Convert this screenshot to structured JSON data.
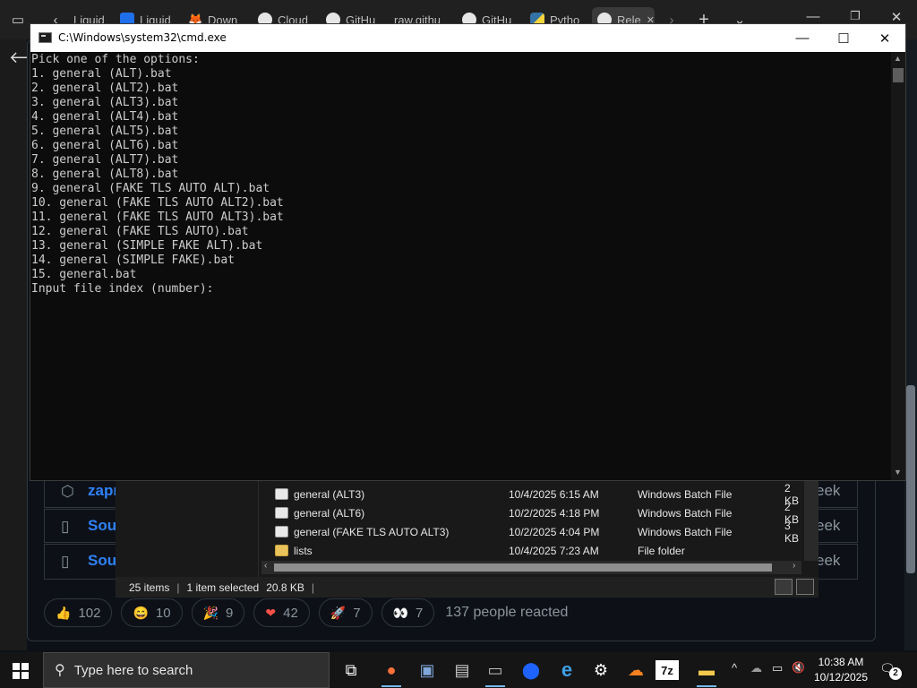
{
  "browser": {
    "tabs": [
      {
        "label": "Liquid",
        "icon": "liquid-icon"
      },
      {
        "label": "Liquid",
        "icon": "liquid-blue-icon"
      },
      {
        "label": "Down",
        "icon": "download-icon"
      },
      {
        "label": "Cloud",
        "icon": "github-icon"
      },
      {
        "label": "GitHu",
        "icon": "github-icon"
      },
      {
        "label": "raw.githu",
        "icon": "none"
      },
      {
        "label": "GitHu",
        "icon": "github-icon"
      },
      {
        "label": "Pytho",
        "icon": "python-icon"
      },
      {
        "label": "Rele",
        "icon": "github-icon",
        "active": true
      }
    ],
    "tab_close": "✕",
    "new_tab": "+",
    "tab_list": "⌄"
  },
  "github": {
    "asset_rows": [
      {
        "icon": "package-icon",
        "label": "zapr",
        "time": "eek"
      },
      {
        "icon": "file-zip-icon",
        "label": "Sour",
        "time": "eek"
      },
      {
        "icon": "file-zip-icon",
        "label": "Sour",
        "time": "eek"
      }
    ],
    "reactions": [
      {
        "emoji": "👍",
        "count": "102",
        "icon": "thumbs-up-icon"
      },
      {
        "emoji": "😄",
        "count": "10",
        "icon": "smile-icon"
      },
      {
        "emoji": "🎉",
        "count": "9",
        "icon": "tada-icon"
      },
      {
        "emoji": "❤",
        "count": "42",
        "icon": "heart-icon"
      },
      {
        "emoji": "🚀",
        "count": "7",
        "icon": "rocket-icon"
      },
      {
        "emoji": "👀",
        "count": "7",
        "icon": "eyes-icon"
      }
    ],
    "reactions_total": "137 people reacted"
  },
  "explorer": {
    "files": [
      {
        "name": "general (ALT3)",
        "date": "10/4/2025 6:15 AM",
        "type": "Windows Batch File",
        "size": "2 KB",
        "kind": "bat"
      },
      {
        "name": "general (ALT6)",
        "date": "10/2/2025 4:18 PM",
        "type": "Windows Batch File",
        "size": "2 KB",
        "kind": "bat"
      },
      {
        "name": "general (FAKE TLS AUTO ALT3)",
        "date": "10/2/2025 4:04 PM",
        "type": "Windows Batch File",
        "size": "3 KB",
        "kind": "bat"
      },
      {
        "name": "lists",
        "date": "10/4/2025 7:23 AM",
        "type": "File folder",
        "size": "",
        "kind": "folder"
      }
    ],
    "status": {
      "items": "25 items",
      "selected": "1 item selected",
      "size": "20.8 KB",
      "separator": "|"
    }
  },
  "cmd": {
    "title": "C:\\Windows\\system32\\cmd.exe",
    "controls": {
      "minimize": "—",
      "maximize": "☐",
      "close": "✕"
    },
    "lines": [
      "Pick one of the options:",
      "1. general (ALT).bat",
      "2. general (ALT2).bat",
      "3. general (ALT3).bat",
      "4. general (ALT4).bat",
      "5. general (ALT5).bat",
      "6. general (ALT6).bat",
      "7. general (ALT7).bat",
      "8. general (ALT8).bat",
      "9. general (FAKE TLS AUTO ALT).bat",
      "10. general (FAKE TLS AUTO ALT2).bat",
      "11. general (FAKE TLS AUTO ALT3).bat",
      "12. general (FAKE TLS AUTO).bat",
      "13. general (SIMPLE FAKE ALT).bat",
      "14. general (SIMPLE FAKE).bat",
      "15. general.bat",
      "Input file index (number): "
    ]
  },
  "taskbar": {
    "search_placeholder": "Type here to search",
    "clock_time": "10:38 AM",
    "clock_date": "10/12/2025",
    "notifications_count": "2",
    "apps": [
      {
        "name": "task-view-icon",
        "glyph": "⧉"
      },
      {
        "name": "firefox-icon",
        "glyph": "●"
      },
      {
        "name": "tool-icon",
        "glyph": "▣"
      },
      {
        "name": "network-tool-icon",
        "glyph": "▤"
      },
      {
        "name": "terminal-icon",
        "glyph": "▭"
      },
      {
        "name": "blue-app-icon",
        "glyph": "⬤"
      },
      {
        "name": "internet-explorer-icon",
        "glyph": "e"
      },
      {
        "name": "settings-icon",
        "glyph": "⚙"
      },
      {
        "name": "cloudflare-icon",
        "glyph": "☁"
      },
      {
        "name": "7zip-icon",
        "glyph": "7z"
      },
      {
        "name": "file-explorer-icon",
        "glyph": "▬"
      }
    ],
    "tray": [
      {
        "name": "show-hidden-icons",
        "glyph": "^"
      },
      {
        "name": "cloud-icon",
        "glyph": "☁"
      },
      {
        "name": "network-icon",
        "glyph": "▭"
      },
      {
        "name": "volume-muted-icon",
        "glyph": "🔇"
      }
    ]
  },
  "colors": {
    "cmd_text": "#cccccc",
    "github_link": "#2f81f7",
    "taskbar_bg": "#151515"
  }
}
